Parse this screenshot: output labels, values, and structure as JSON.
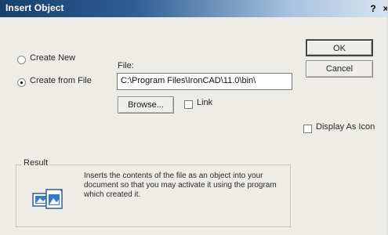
{
  "window": {
    "title": "Insert Object",
    "help_glyph": "?",
    "close_glyph": "×"
  },
  "options": {
    "create_new_label": "Create New",
    "create_from_file_label": "Create from File",
    "selected": "create_from_file"
  },
  "file": {
    "label": "File:",
    "value": "C:\\Program Files\\IronCAD\\11.0\\bin\\",
    "browse_label": "Browse...",
    "link_label": "Link",
    "link_checked": false
  },
  "buttons": {
    "ok_label": "OK",
    "cancel_label": "Cancel"
  },
  "display": {
    "display_as_icon_label": "Display As Icon",
    "display_as_icon_checked": false
  },
  "result": {
    "legend": "Result",
    "text": "Inserts the contents of the file as an object into your document so that you may activate it using the program which created it.",
    "icon": "insert-object-icon"
  },
  "colors": {
    "titlebar_start": "#17406f",
    "titlebar_end": "#d6e3f1",
    "dialog_bg": "#eeece6"
  }
}
